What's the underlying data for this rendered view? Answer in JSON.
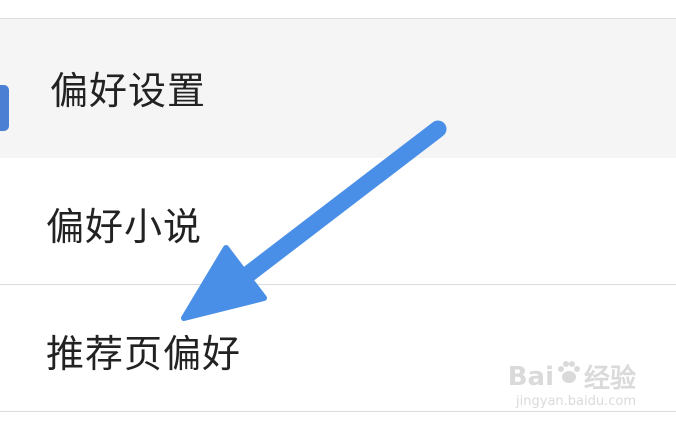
{
  "menu": {
    "items": [
      {
        "label": "偏好设置",
        "selected": true
      },
      {
        "label": "偏好小说",
        "selected": false
      },
      {
        "label": "推荐页偏好",
        "selected": false
      }
    ]
  },
  "colors": {
    "accent": "#4a7fd4",
    "arrow": "#4a8fe7",
    "selected_row_bg": "#f5f5f5",
    "divider": "#dcdcdc",
    "text": "#222222"
  },
  "watermark": {
    "brand_left": "Bai",
    "brand_right": "经验",
    "url": "jingyan.baidu.com"
  },
  "annotation": {
    "icon": "arrow-icon",
    "points_to": "推荐页偏好"
  }
}
